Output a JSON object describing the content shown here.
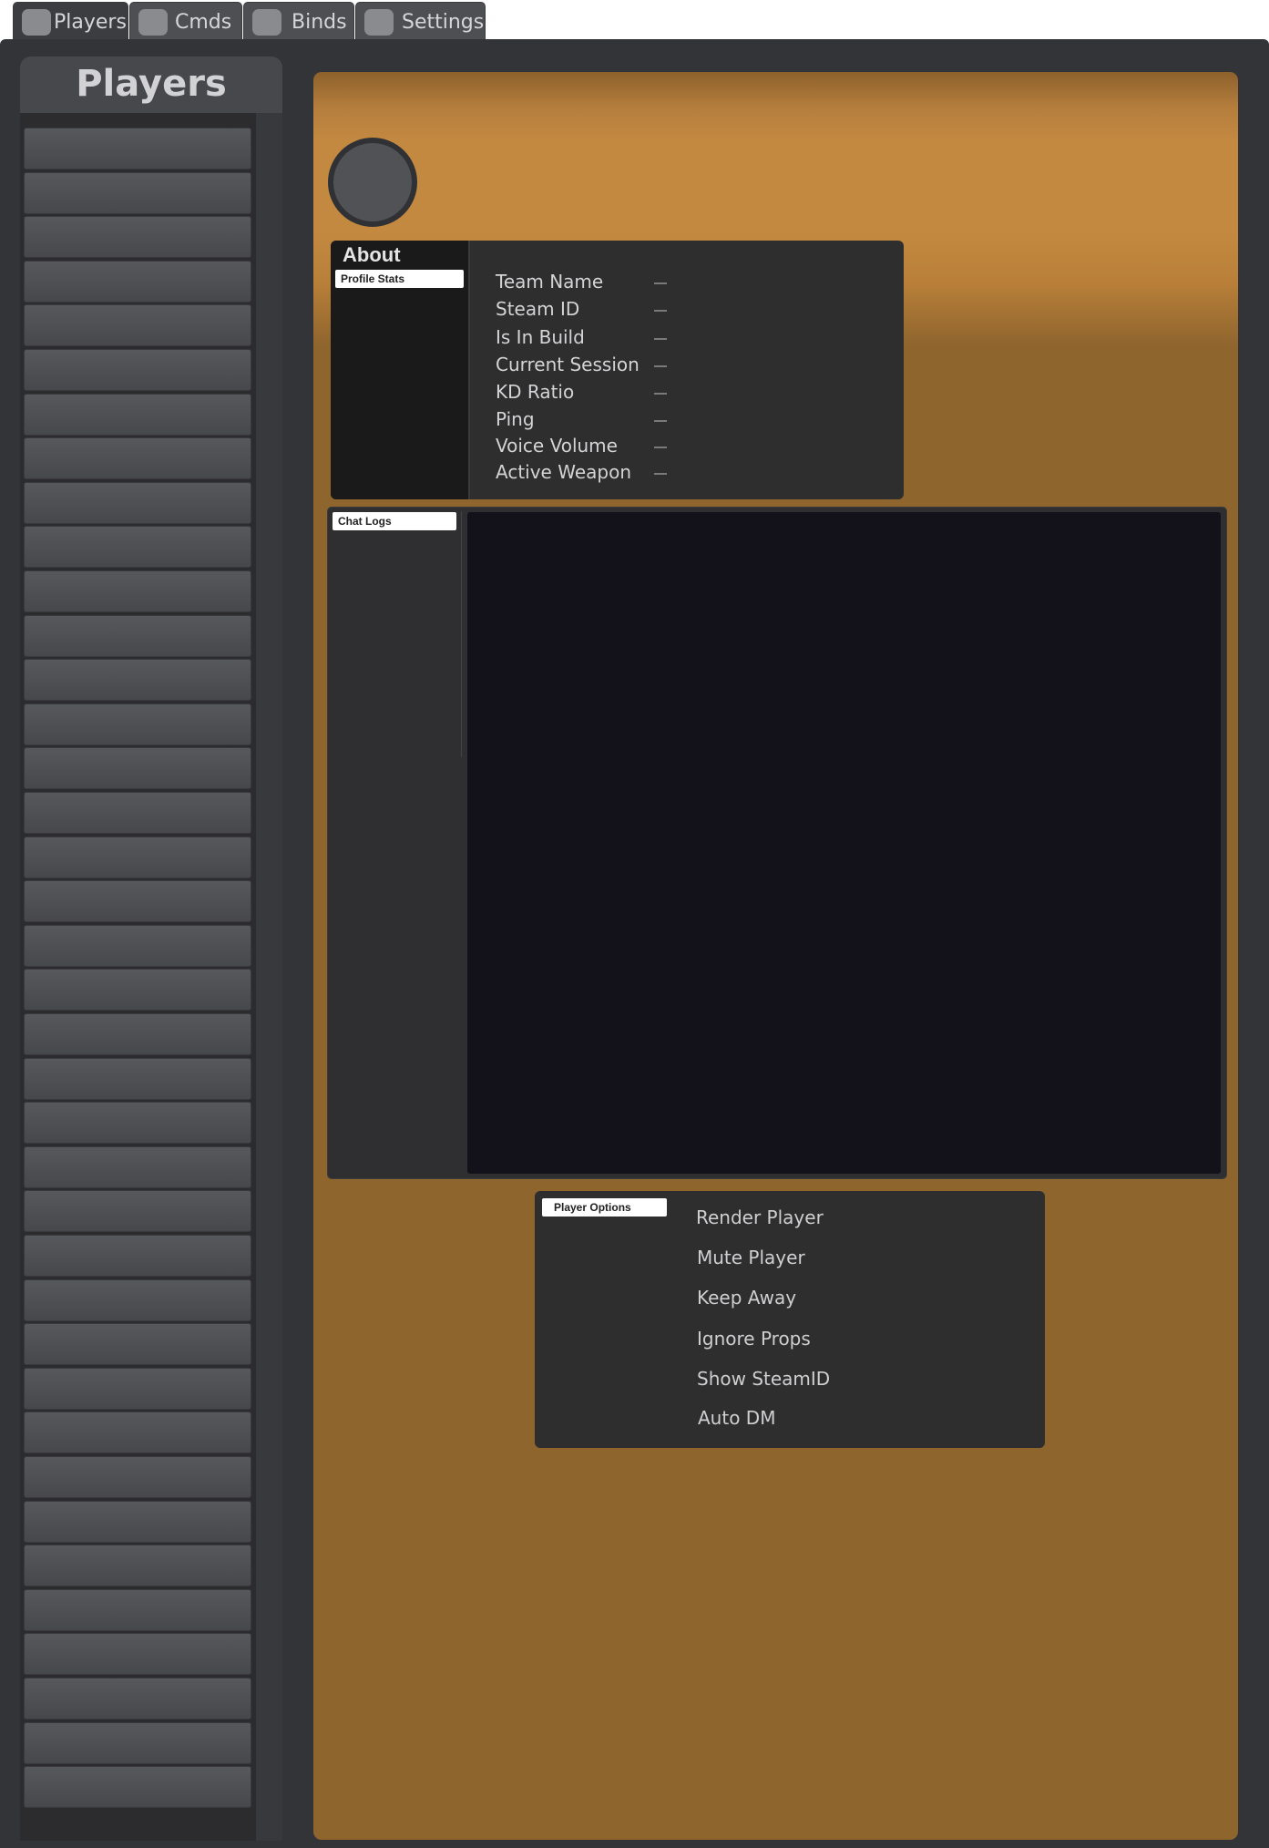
{
  "tabs": [
    {
      "label": "Players",
      "icon": "players-icon",
      "active": true
    },
    {
      "label": "Cmds",
      "icon": "cmds-icon",
      "active": false
    },
    {
      "label": "Binds",
      "icon": "binds-icon",
      "active": false
    },
    {
      "label": "Settings",
      "icon": "settings-icon",
      "active": false
    }
  ],
  "sidebar": {
    "title": "Players",
    "player_count": 38
  },
  "profile": {
    "background_color": "#c38941",
    "about": {
      "title": "About",
      "section_label": "Profile Stats",
      "stats": [
        {
          "label": "Team Name",
          "value": "—"
        },
        {
          "label": "Steam ID",
          "value": "—"
        },
        {
          "label": "Is In Build",
          "value": "—"
        },
        {
          "label": "Current Session",
          "value": "—"
        },
        {
          "label": "KD Ratio",
          "value": "—"
        },
        {
          "label": "Ping",
          "value": "—"
        },
        {
          "label": "Voice Volume",
          "value": "—"
        },
        {
          "label": "Active Weapon",
          "value": "—"
        }
      ]
    },
    "chat": {
      "section_label": "Chat Logs"
    },
    "options": {
      "section_label": "Player Options",
      "items": [
        "Render Player",
        "Mute Player",
        "Keep Away",
        "Ignore Props",
        "Show SteamID",
        "Auto DM"
      ]
    }
  }
}
